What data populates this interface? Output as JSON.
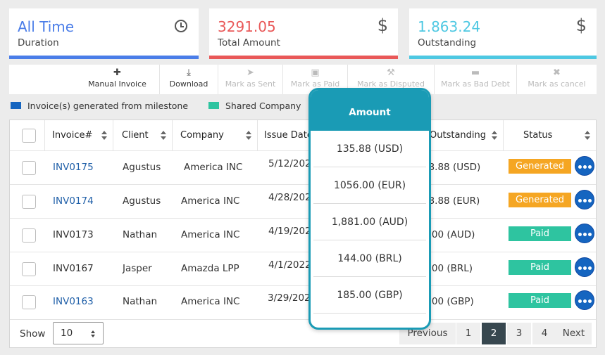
{
  "cards": [
    {
      "value": "All Time",
      "label": "Duration",
      "color": "#4a7de8",
      "icon": "clock-icon"
    },
    {
      "value": "3291.05",
      "label": "Total Amount",
      "color": "#e95858",
      "icon": "dollar-icon",
      "icon_glyph": "$"
    },
    {
      "value": "1.863.24",
      "label": "Outstanding",
      "color": "#4ec8e2",
      "icon": "dollar-icon",
      "icon_glyph": "$"
    }
  ],
  "toolbar": [
    {
      "label": "Manual Invoice",
      "icon": "plus-icon",
      "glyph": "✚",
      "enabled": true
    },
    {
      "label": "Download",
      "icon": "download-icon",
      "glyph": "⤓",
      "enabled": true
    },
    {
      "label": "Mark as Sent",
      "icon": "send-icon",
      "glyph": "➤",
      "enabled": false
    },
    {
      "label": "Mark as Paid",
      "icon": "money-icon",
      "glyph": "▣",
      "enabled": false
    },
    {
      "label": "Mark as Disputed",
      "icon": "gavel-icon",
      "glyph": "⚒",
      "enabled": false
    },
    {
      "label": "Mark as Bad Debt",
      "icon": "card-icon",
      "glyph": "▬",
      "enabled": false
    },
    {
      "label": "Mark as cancel",
      "icon": "close-icon",
      "glyph": "✖",
      "enabled": false
    }
  ],
  "legend": [
    {
      "label": "Invoice(s) generated from milestone",
      "color": "#1565c0"
    },
    {
      "label": "Shared Company",
      "color": "#2ec4a0"
    }
  ],
  "table": {
    "columns": [
      "Invoice#",
      "Client",
      "Company",
      "Issue Date",
      "Outstanding",
      "Status"
    ],
    "rows": [
      {
        "invoice": "INV0175",
        "link": true,
        "client": "Agustus",
        "company": "America INC",
        "date": "5/12/2022",
        "outstanding": "13.88 (USD)",
        "status": "Generated"
      },
      {
        "invoice": "INV0174",
        "link": true,
        "client": "Agustus",
        "company": "America INC",
        "date": "4/28/2022",
        "outstanding": "13.88 (EUR)",
        "status": "Generated"
      },
      {
        "invoice": "INV0173",
        "link": false,
        "client": "Nathan",
        "company": "America INC",
        "date": "4/19/2022",
        "outstanding": "0.00 (AUD)",
        "status": "Paid"
      },
      {
        "invoice": "INV0167",
        "link": false,
        "client": "Jasper",
        "company": "Amazda LPP",
        "date": "4/1/2022",
        "outstanding": "0.00 (BRL)",
        "status": "Paid"
      },
      {
        "invoice": "INV0163",
        "link": true,
        "client": "Nathan",
        "company": "America INC",
        "date": "3/29/2022",
        "outstanding": "0.00 (GBP)",
        "status": "Paid"
      }
    ]
  },
  "status_colors": {
    "Generated": "#f5a623",
    "Paid": "#2ec4a0"
  },
  "amount_popup": {
    "header": "Amount",
    "values": [
      "135.88 (USD)",
      "1056.00 (EUR)",
      "1,881.00 (AUD)",
      "144.00 (BRL)",
      "185.00 (GBP)"
    ]
  },
  "footer": {
    "show_label": "Show",
    "page_size": "10",
    "previous": "Previous",
    "pages": [
      "1",
      "2",
      "3",
      "4"
    ],
    "current_page": "2",
    "next": "Next"
  }
}
